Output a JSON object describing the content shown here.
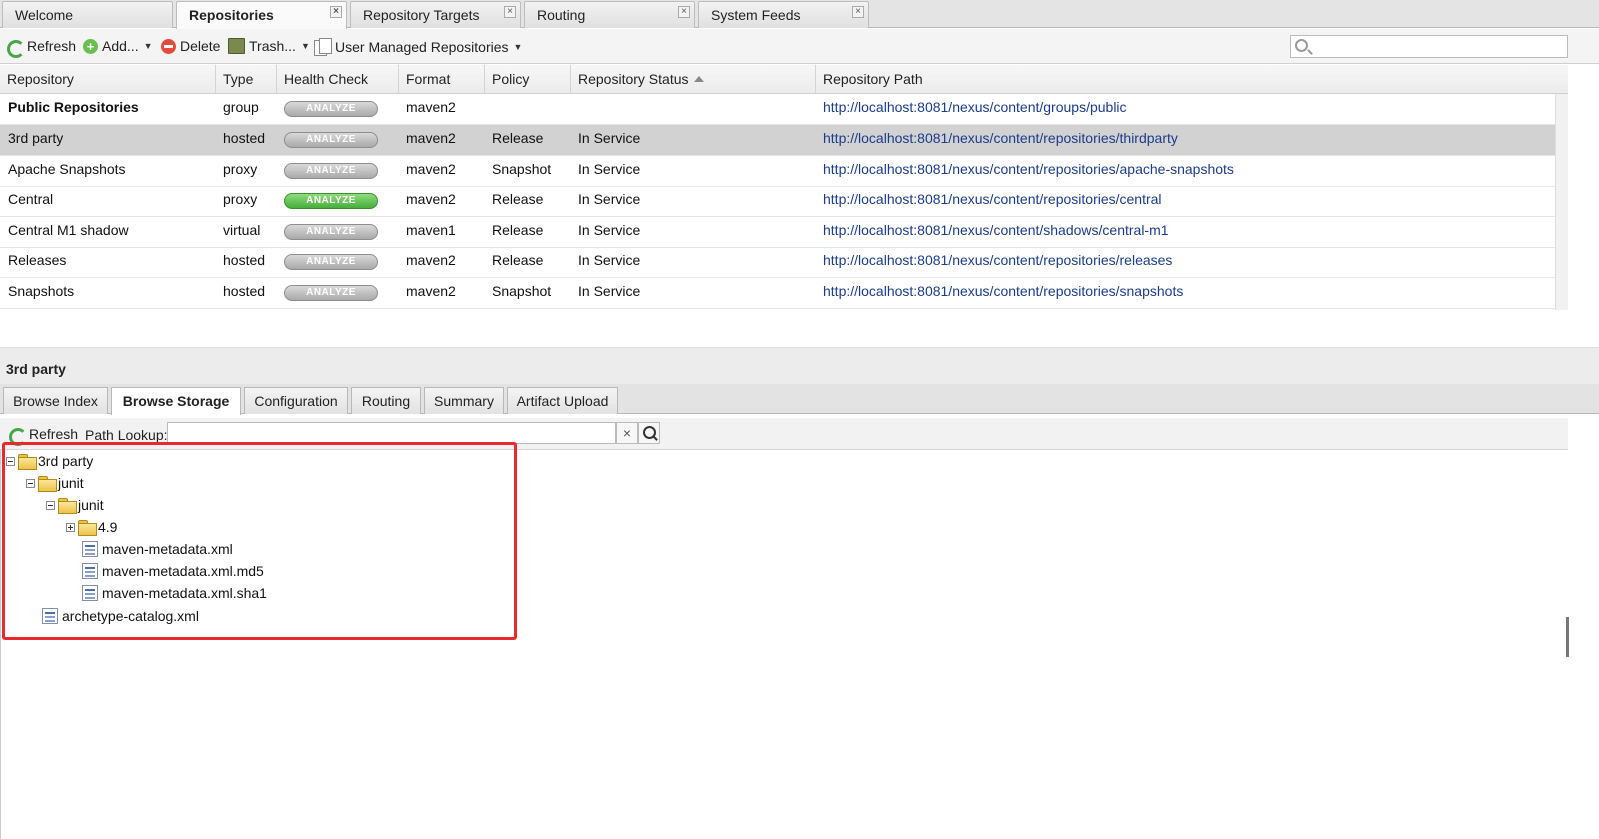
{
  "top_tabs": [
    {
      "label": "Welcome"
    },
    {
      "label": "Repositories"
    },
    {
      "label": "Repository Targets"
    },
    {
      "label": "Routing"
    },
    {
      "label": "System Feeds"
    }
  ],
  "tab_close_glyph": "×",
  "toolbar": {
    "refresh": "Refresh",
    "add": "Add...",
    "delete": "Delete",
    "trash": "Trash...",
    "user_managed": "User Managed Repositories",
    "search_placeholder": ""
  },
  "grid": {
    "columns": [
      "Repository",
      "Type",
      "Health Check",
      "Format",
      "Policy",
      "Repository Status",
      "Repository Path"
    ],
    "analyze_label": "ANALYZE",
    "rows": [
      {
        "name": "Public Repositories",
        "type": "group",
        "health": "gray",
        "format": "maven2",
        "policy": "",
        "status": "",
        "path": "http://localhost:8081/nexus/content/groups/public"
      },
      {
        "name": "3rd party",
        "type": "hosted",
        "health": "gray",
        "format": "maven2",
        "policy": "Release",
        "status": "In Service",
        "path": "http://localhost:8081/nexus/content/repositories/thirdparty"
      },
      {
        "name": "Apache Snapshots",
        "type": "proxy",
        "health": "gray",
        "format": "maven2",
        "policy": "Snapshot",
        "status": "In Service",
        "path": "http://localhost:8081/nexus/content/repositories/apache-snapshots"
      },
      {
        "name": "Central",
        "type": "proxy",
        "health": "green",
        "format": "maven2",
        "policy": "Release",
        "status": "In Service",
        "path": "http://localhost:8081/nexus/content/repositories/central"
      },
      {
        "name": "Central M1 shadow",
        "type": "virtual",
        "health": "gray",
        "format": "maven1",
        "policy": "Release",
        "status": "In Service",
        "path": "http://localhost:8081/nexus/content/shadows/central-m1"
      },
      {
        "name": "Releases",
        "type": "hosted",
        "health": "gray",
        "format": "maven2",
        "policy": "Release",
        "status": "In Service",
        "path": "http://localhost:8081/nexus/content/repositories/releases"
      },
      {
        "name": "Snapshots",
        "type": "hosted",
        "health": "gray",
        "format": "maven2",
        "policy": "Snapshot",
        "status": "In Service",
        "path": "http://localhost:8081/nexus/content/repositories/snapshots"
      }
    ]
  },
  "detail": {
    "title": "3rd party",
    "tabs": [
      "Browse Index",
      "Browse Storage",
      "Configuration",
      "Routing",
      "Summary",
      "Artifact Upload"
    ],
    "toolbar": {
      "refresh": "Refresh",
      "path_lookup_label": "Path Lookup:",
      "path_value": "",
      "clear_glyph": "×"
    },
    "tree": [
      {
        "label": "3rd party",
        "kind": "folder",
        "toggle": "minus"
      },
      {
        "label": "junit",
        "kind": "folder",
        "toggle": "minus"
      },
      {
        "label": "junit",
        "kind": "folder",
        "toggle": "minus"
      },
      {
        "label": "4.9",
        "kind": "folder",
        "toggle": "plus"
      },
      {
        "label": "maven-metadata.xml",
        "kind": "file"
      },
      {
        "label": "maven-metadata.xml.md5",
        "kind": "file"
      },
      {
        "label": "maven-metadata.xml.sha1",
        "kind": "file"
      },
      {
        "label": "archetype-catalog.xml",
        "kind": "file"
      }
    ]
  },
  "colors": {
    "highlight": "#e8292e",
    "link": "#1a3c8c",
    "selected_row": "#d2d2d2",
    "analyze_green": "#48ad3c"
  }
}
